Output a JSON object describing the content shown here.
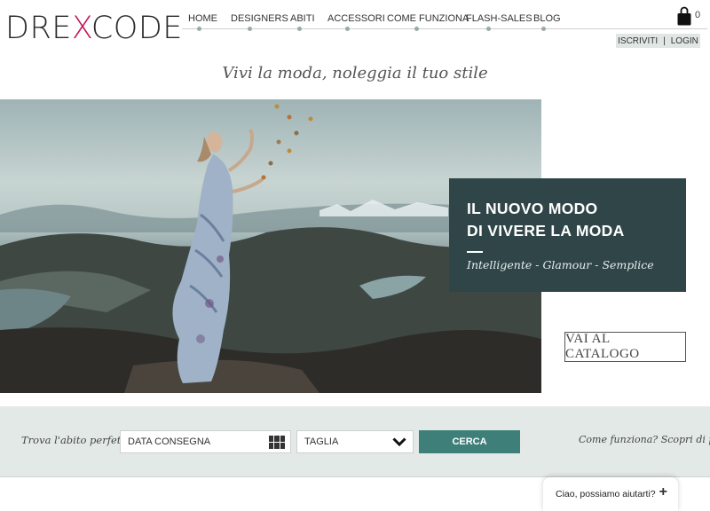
{
  "header": {
    "logo_left": "DRE",
    "logo_x": "X",
    "logo_right": "CODE",
    "nav": [
      "HOME",
      "DESIGNERS",
      "ABITI",
      "ACCESSORI",
      "COME FUNZIONA",
      "FLASH-SALES",
      "BLOG"
    ],
    "cart_count": "0",
    "signup": "ISCRIVITI",
    "separator": "|",
    "login": "LOGIN"
  },
  "tagline": "Vivi la moda, noleggia il tuo stile",
  "hero": {
    "promo_title_line1": "IL NUOVO MODO",
    "promo_title_line2": "DI VIVERE LA MODA",
    "promo_subtitle": "Intelligente - Glamour - Semplice",
    "catalog_button": "VAI AL CATALOGO"
  },
  "search": {
    "label": "Trova l'abito perfetto",
    "date_value": "DATA CONSEGNA",
    "size_value": "TAGLIA",
    "button": "CERCA",
    "how_link": "Come funziona? Scopri di più"
  },
  "chat": {
    "label": "Ciao, possiamo aiutarti?",
    "plus": "+"
  },
  "icons": {
    "cart": "shopping-bag-icon",
    "calendar": "calendar-grid-icon",
    "select": "chevron-down-icon",
    "chat": "plus-icon"
  },
  "colors": {
    "brand_accent": "#c4185a",
    "promo_bg": "#304548",
    "search_button": "#3e7f7a",
    "search_bar_bg": "#e3e9e7"
  }
}
